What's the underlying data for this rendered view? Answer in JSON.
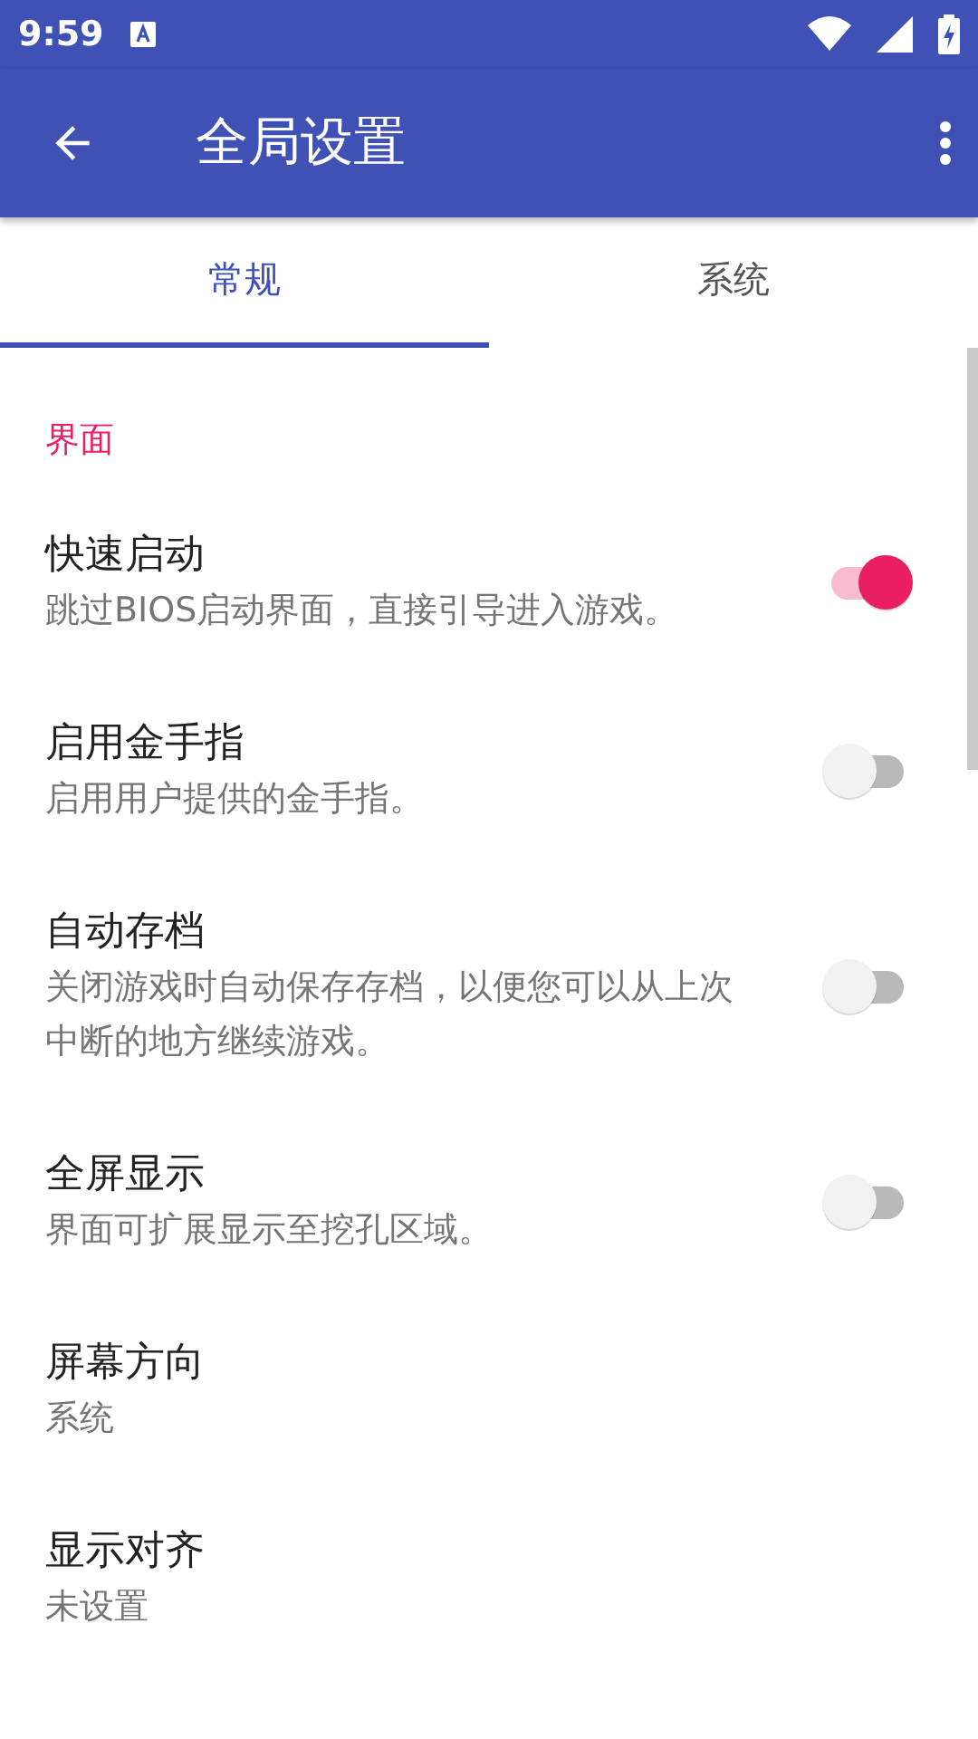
{
  "status_bar": {
    "time": "9:59"
  },
  "app_bar": {
    "title": "全局设置"
  },
  "tabs": [
    {
      "label": "常规",
      "selected": true
    },
    {
      "label": "系统",
      "selected": false
    }
  ],
  "section": {
    "header": "界面",
    "items": [
      {
        "kind": "switch",
        "title": "快速启动",
        "summary": "跳过BIOS启动界面，直接引导进入游戏。",
        "on": true
      },
      {
        "kind": "switch",
        "title": "启用金手指",
        "summary": "启用用户提供的金手指。",
        "on": false
      },
      {
        "kind": "switch",
        "title": "自动存档",
        "summary": "关闭游戏时自动保存存档，以便您可以从上次中断的地方继续游戏。",
        "on": false
      },
      {
        "kind": "switch",
        "title": "全屏显示",
        "summary": "界面可扩展显示至挖孔区域。",
        "on": false
      },
      {
        "kind": "text",
        "title": "屏幕方向",
        "summary": "系统"
      },
      {
        "kind": "text",
        "title": "显示对齐",
        "summary": "未设置"
      }
    ]
  }
}
